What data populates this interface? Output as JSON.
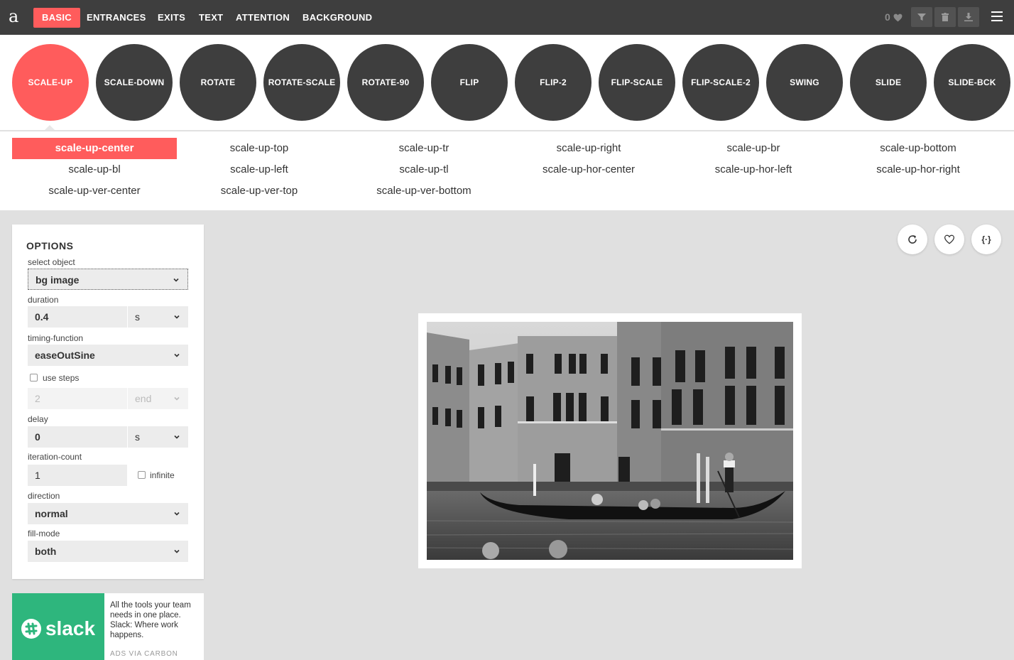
{
  "header": {
    "logo": "a",
    "tabs": [
      "BASIC",
      "ENTRANCES",
      "EXITS",
      "TEXT",
      "ATTENTION",
      "BACKGROUND"
    ],
    "favorites_count": "0"
  },
  "categories": [
    "SCALE-UP",
    "SCALE-DOWN",
    "ROTATE",
    "ROTATE-SCALE",
    "ROTATE-90",
    "FLIP",
    "FLIP-2",
    "FLIP-SCALE",
    "FLIP-SCALE-2",
    "SWING",
    "SLIDE",
    "SLIDE-BCK"
  ],
  "variants": [
    "scale-up-center",
    "scale-up-top",
    "scale-up-tr",
    "scale-up-right",
    "scale-up-br",
    "scale-up-bottom",
    "scale-up-bl",
    "scale-up-left",
    "scale-up-tl",
    "scale-up-hor-center",
    "scale-up-hor-left",
    "scale-up-hor-right",
    "scale-up-ver-center",
    "scale-up-ver-top",
    "scale-up-ver-bottom"
  ],
  "options": {
    "title": "OPTIONS",
    "select_object_label": "select object",
    "select_object_value": "bg image",
    "duration_label": "duration",
    "duration_value": "0.4",
    "duration_unit": "s",
    "timing_label": "timing-function",
    "timing_value": "easeOutSine",
    "use_steps_label": "use steps",
    "steps_value": "2",
    "steps_position": "end",
    "delay_label": "delay",
    "delay_value": "0",
    "delay_unit": "s",
    "iteration_label": "iteration-count",
    "iteration_value": "1",
    "infinite_label": "infinite",
    "direction_label": "direction",
    "direction_value": "normal",
    "fill_mode_label": "fill-mode",
    "fill_mode_value": "both"
  },
  "preview": {
    "code_label": "{·}"
  },
  "ad": {
    "brand": "slack",
    "text": "All the tools your team needs in one place. Slack: Where work happens.",
    "via": "ADS VIA CARBON"
  },
  "colors": {
    "accent": "#ff5c5c",
    "dark": "#3e3e3e",
    "slack_green": "#2eb67d"
  }
}
